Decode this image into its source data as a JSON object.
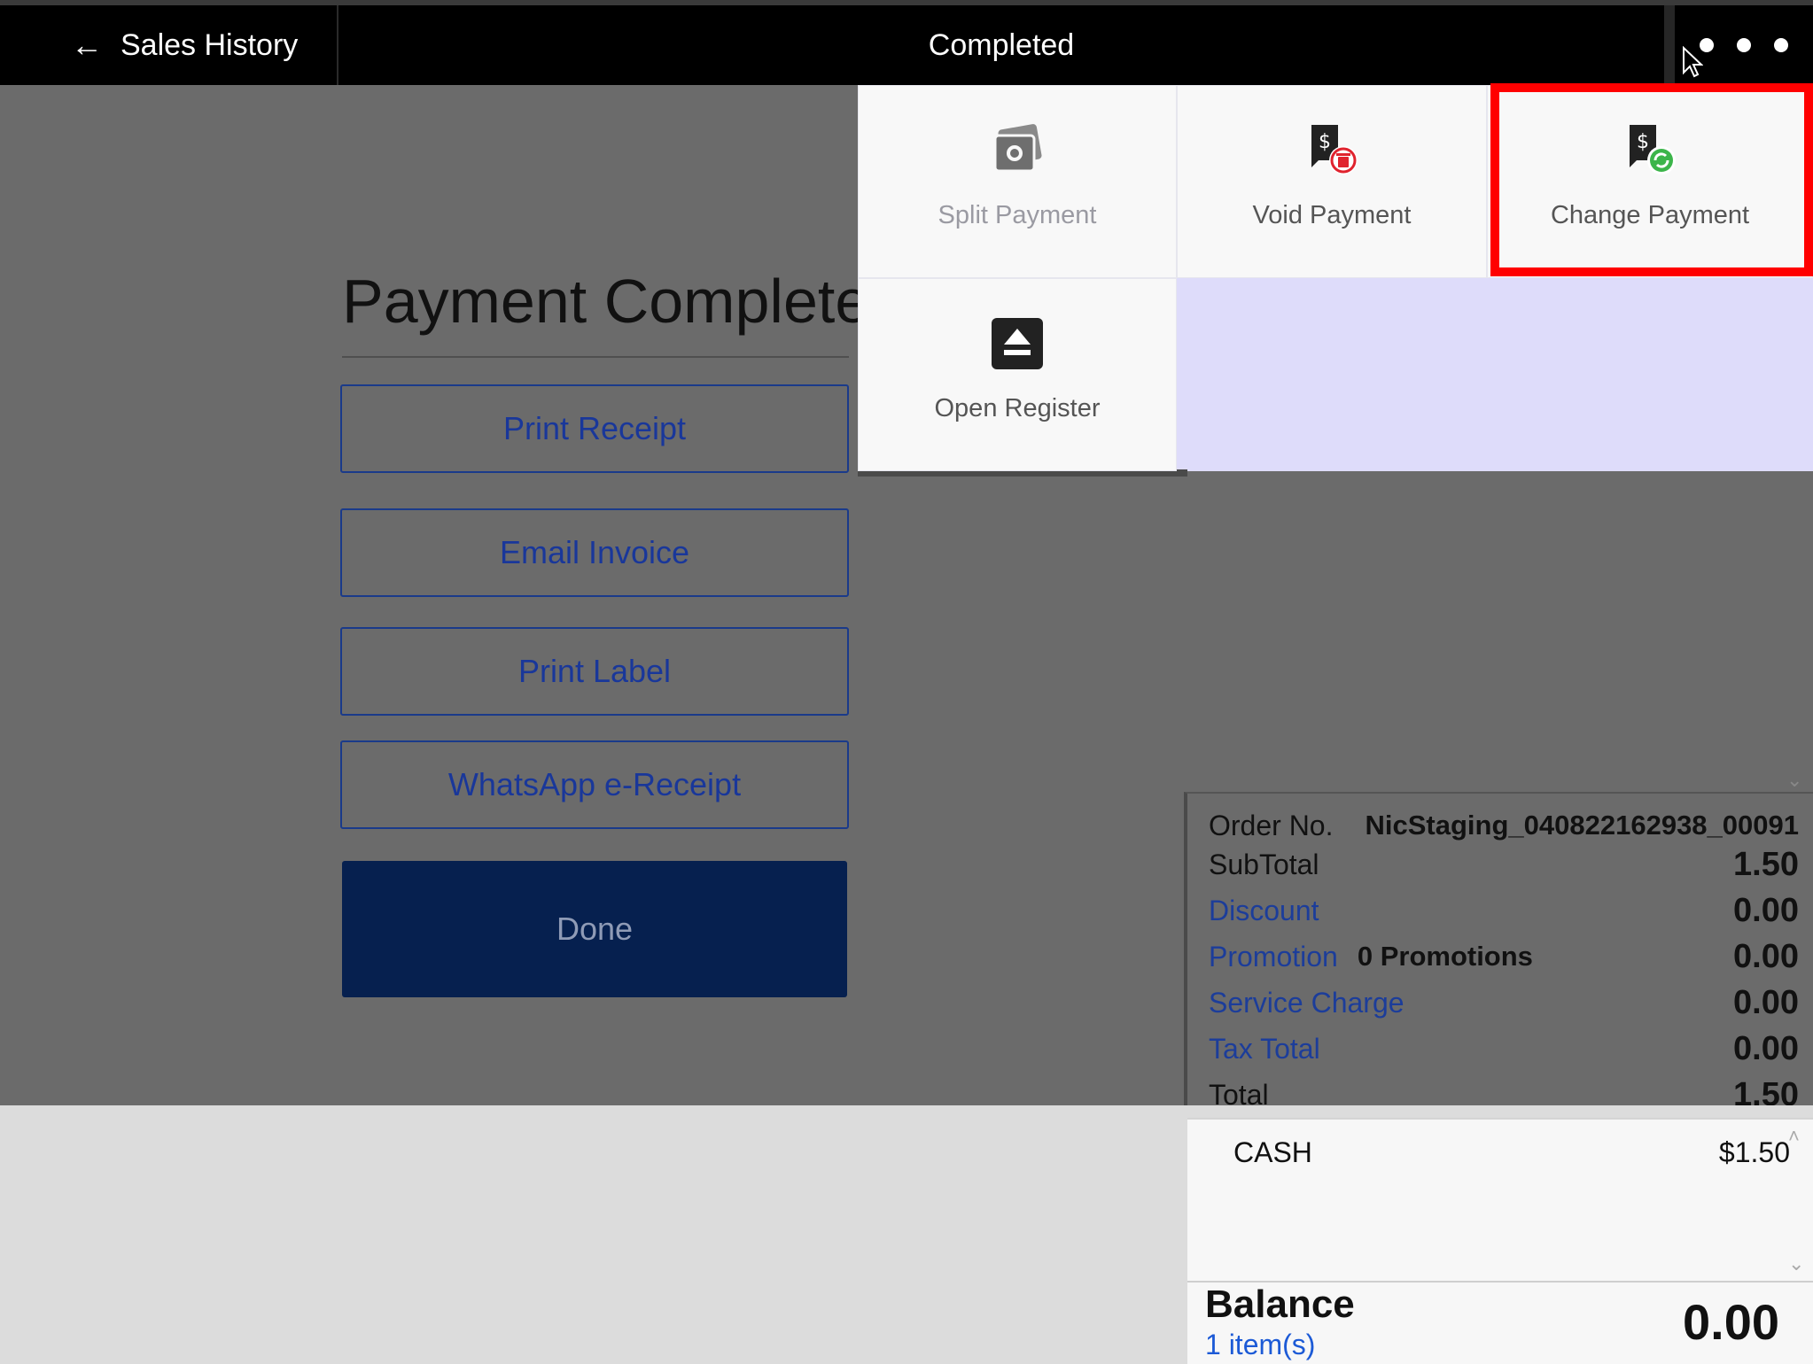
{
  "header": {
    "back_label": "Sales History",
    "back_arrow": "←",
    "title": "Completed"
  },
  "main": {
    "title": "Payment Complete",
    "buttons": {
      "print_receipt": "Print Receipt",
      "email_invoice": "Email Invoice",
      "print_label": "Print Label",
      "whatsapp": "WhatsApp e-Receipt",
      "done": "Done"
    }
  },
  "menu": {
    "items": [
      {
        "label": "Split Payment",
        "icon": "cash-stack-icon"
      },
      {
        "label": "Void Payment",
        "icon": "void-payment-icon"
      },
      {
        "label": "Change Payment",
        "icon": "change-payment-icon"
      },
      {
        "label": "Open Register",
        "icon": "eject-icon"
      }
    ],
    "highlighted": "Change Payment"
  },
  "summary": {
    "order_label": "Order No.",
    "order_number": "NicStaging_040822162938_00091",
    "subtotal_label": "SubTotal",
    "subtotal_value": "1.50",
    "discount_label": "Discount",
    "discount_value": "0.00",
    "promotion_label": "Promotion",
    "promotion_count": "0 Promotions",
    "promotion_value": "0.00",
    "service_label": "Service Charge",
    "service_value": "0.00",
    "tax_label": "Tax Total",
    "tax_value": "0.00",
    "total_label": "Total",
    "total_value": "1.50"
  },
  "payments": [
    {
      "method": "CASH",
      "amount": "$1.50"
    }
  ],
  "balance": {
    "label": "Balance",
    "items": "1 item(s)",
    "value": "0.00"
  },
  "colors": {
    "highlight": "#ff0000",
    "done_button": "#06204f",
    "link_blue": "#1c3d9a",
    "menu_empty": "#dedcfa"
  }
}
